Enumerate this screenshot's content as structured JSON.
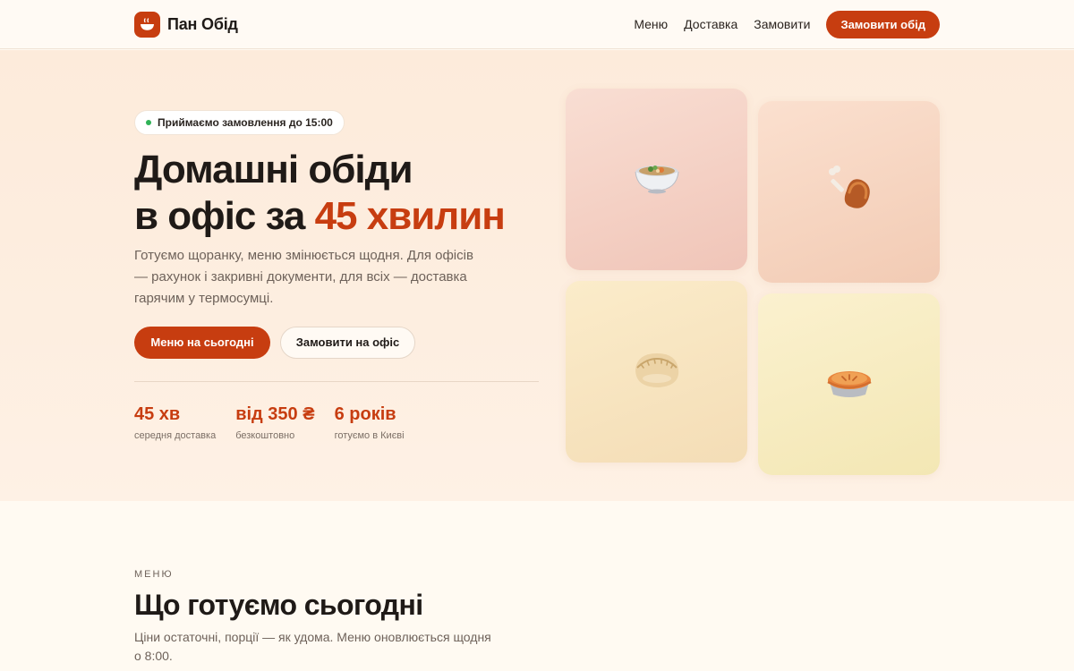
{
  "brand": {
    "name": "Пан Обід",
    "accent": "#c73d10",
    "logo_icon": "soup-bowl-icon"
  },
  "nav": {
    "links": [
      "Меню",
      "Доставка",
      "Замовити"
    ],
    "cta": "Замовити обід"
  },
  "hero": {
    "badge": "Приймаємо замовлення до 15:00",
    "badge_status_color": "#2fb257",
    "title_line1": "Домашні обіди",
    "title_line2_prefix": "в офіс за ",
    "title_line2_accent": "45 хвилин",
    "subtitle": "Готуємо щоранку, меню змінюється щодня. Для офісів — рахунок і закривні документи, для всіх — доставка гарячим у термосумці.",
    "primary_button": "Меню на сьогодні",
    "secondary_button": "Замовити на офіс",
    "stats": [
      {
        "value": "45 хв",
        "label": "середня доставка"
      },
      {
        "value": "від 350 ₴",
        "label": "безкоштовно"
      },
      {
        "value": "6 років",
        "label": "готуємо в Києві"
      }
    ],
    "tiles": [
      {
        "icon": "soup-bowl-icon"
      },
      {
        "icon": "chicken-leg-icon"
      },
      {
        "icon": "dumpling-icon"
      },
      {
        "icon": "pie-icon"
      }
    ]
  },
  "menu": {
    "eyebrow": "МЕНЮ",
    "title": "Що готуємо сьогодні",
    "subtitle": "Ціни остаточні, порції — як удома. Меню оновлюється щодня о 8:00."
  }
}
